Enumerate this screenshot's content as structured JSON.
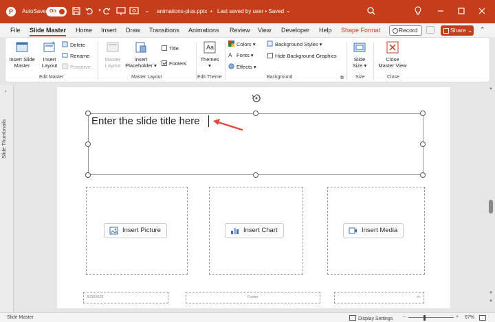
{
  "titlebar": {
    "autosave_label": "AutoSave",
    "autosave_state": "On",
    "filename": "animations-plus.pptx",
    "separator": "•",
    "save_status": "Last saved by user • Saved",
    "chevron": "⌄",
    "icons": [
      "save-icon",
      "undo-icon",
      "redo-icon",
      "start-from-beginning-icon",
      "presenter-icon",
      "qat-more-icon",
      "search-icon",
      "lightbulb-icon",
      "minimize-icon",
      "restore-icon",
      "close-icon"
    ]
  },
  "tabs": [
    {
      "label": "File"
    },
    {
      "label": "Slide Master",
      "active": true
    },
    {
      "label": "Home"
    },
    {
      "label": "Insert"
    },
    {
      "label": "Draw"
    },
    {
      "label": "Transitions"
    },
    {
      "label": "Animations"
    },
    {
      "label": "Review"
    },
    {
      "label": "View"
    },
    {
      "label": "Developer"
    },
    {
      "label": "Help"
    },
    {
      "label": "Shape Format",
      "contextual": true
    }
  ],
  "toolbar_right": {
    "record_label": "Record",
    "share_label": "Share",
    "share_chevron": "⌄",
    "collapse_glyph": "⌃"
  },
  "ribbon": {
    "edit_master": {
      "label": "Edit Master",
      "insert_slide_master": [
        "Insert Slide",
        "Master"
      ],
      "insert_layout": [
        "Insert",
        "Layout"
      ],
      "delete": "Delete",
      "rename": "Rename",
      "preserve": "Preserve"
    },
    "master_layout": {
      "label": "Master Layout",
      "master_layout_btn": [
        "Master",
        "Layout"
      ],
      "insert_placeholder": [
        "Insert",
        "Placeholder"
      ],
      "title_checkbox": "Title",
      "footers_checkbox": "Footers",
      "title_checked": false,
      "footers_checked": true
    },
    "edit_theme": {
      "label": "Edit Theme",
      "themes": "Themes"
    },
    "background": {
      "label": "Background",
      "colors": "Colors",
      "fonts": "Fonts",
      "effects": "Effects",
      "background_styles": "Background Styles",
      "hide_background_graphics": "Hide Background Graphics",
      "hide_checked": false
    },
    "size": {
      "label": "Size",
      "slide_size": [
        "Slide",
        "Size"
      ]
    },
    "close": {
      "label": "Close",
      "close_master_view": [
        "Close",
        "Master View"
      ]
    },
    "dropdown_glyph": "▾",
    "launcher_glyph": "⧉"
  },
  "side_panel": {
    "label": "Slide Thumbnails",
    "arrow": "›"
  },
  "slide": {
    "title_placeholder": "Enter the slide title here",
    "content_placeholders": [
      {
        "label": "Insert Picture",
        "icon": "picture-icon"
      },
      {
        "label": "Insert Chart",
        "icon": "chart-icon"
      },
      {
        "label": "Insert Media",
        "icon": "media-icon"
      }
    ],
    "footer_date": "8/20/2025",
    "footer_text": "Footer",
    "slide_number": "‹#›"
  },
  "statusbar": {
    "left": "Slide Master",
    "display_settings": "Display Settings",
    "zoom_minus": "−",
    "zoom_plus": "+",
    "zoom_percent": "67%"
  },
  "colors": {
    "brand": "#c43e1c",
    "annotation_arrow": "#e0463a"
  }
}
